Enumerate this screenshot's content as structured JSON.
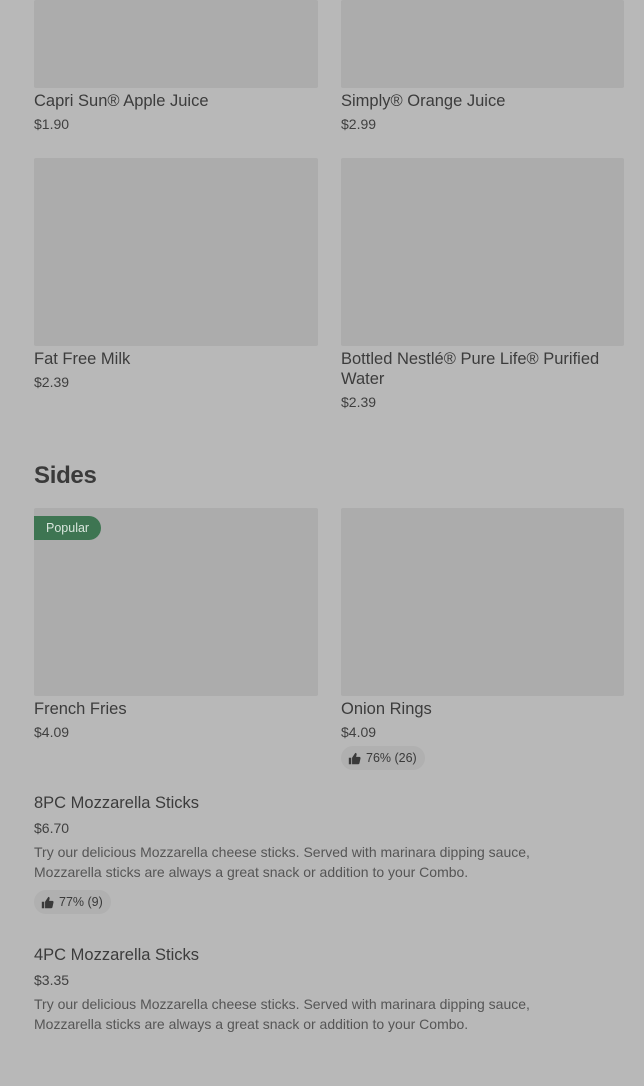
{
  "drinks": [
    {
      "name": "Capri Sun® Apple Juice",
      "price": "$1.90"
    },
    {
      "name": "Simply® Orange Juice",
      "price": "$2.99"
    },
    {
      "name": "Fat Free Milk",
      "price": "$2.39"
    },
    {
      "name": "Bottled Nestlé® Pure Life® Purified Water",
      "price": "$2.39"
    }
  ],
  "sides": {
    "title": "Sides",
    "cards": [
      {
        "name": "French Fries",
        "price": "$4.09",
        "badge": "Popular"
      },
      {
        "name": "Onion Rings",
        "price": "$4.09",
        "rating": "76% (26)"
      }
    ],
    "list": [
      {
        "name": "8PC Mozzarella Sticks",
        "price": "$6.70",
        "description": "Try our delicious Mozzarella cheese sticks. Served with marinara dipping sauce, Mozzarella sticks are always a great snack or addition to your Combo.",
        "rating": "77% (9)"
      },
      {
        "name": "4PC Mozzarella Sticks",
        "price": "$3.35",
        "description": "Try our delicious Mozzarella cheese sticks. Served with marinara dipping sauce, Mozzarella sticks are always a great snack or addition to your Combo."
      }
    ]
  },
  "colors": {
    "background": "#b8b8b8",
    "image_placeholder": "#acacac",
    "popular_badge": "#3e7552"
  },
  "icons": {
    "rating": "thumbs-up-icon"
  }
}
